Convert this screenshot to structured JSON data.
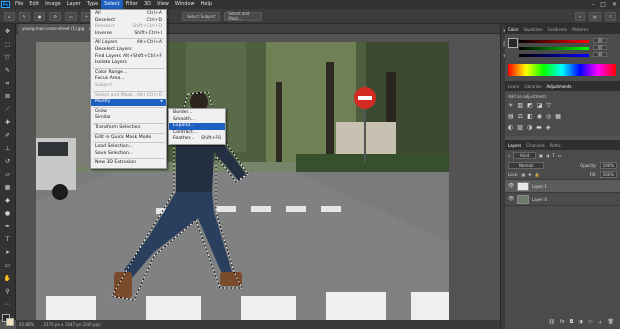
{
  "menubar": {
    "logo": "Ps",
    "items": [
      "File",
      "Edit",
      "Image",
      "Layer",
      "Type",
      "Select",
      "Filter",
      "3D",
      "View",
      "Window",
      "Help"
    ],
    "active_index": 5
  },
  "options": {
    "anti_alias_label": "Anti-alias",
    "select_subject": "Select Subject",
    "select_mask": "Select and Mask..."
  },
  "document": {
    "tab_label": "young-man-cross-street (1).jpg"
  },
  "status": {
    "zoom": "42.86%",
    "info": "2170 px x 1447 px (240 ppi)"
  },
  "select_menu": {
    "items": [
      {
        "label": "All",
        "shortcut": "Ctrl+A",
        "disabled": false
      },
      {
        "label": "Deselect",
        "shortcut": "Ctrl+D",
        "disabled": false
      },
      {
        "label": "Reselect",
        "shortcut": "Shift+Ctrl+D",
        "disabled": true
      },
      {
        "label": "Inverse",
        "shortcut": "Shift+Ctrl+I",
        "disabled": false
      },
      {
        "sep": true
      },
      {
        "label": "All Layers",
        "shortcut": "Alt+Ctrl+A",
        "disabled": false
      },
      {
        "label": "Deselect Layers",
        "shortcut": "",
        "disabled": false
      },
      {
        "label": "Find Layers",
        "shortcut": "Alt+Shift+Ctrl+F",
        "disabled": false
      },
      {
        "label": "Isolate Layers",
        "shortcut": "",
        "disabled": false
      },
      {
        "sep": true
      },
      {
        "label": "Color Range...",
        "shortcut": "",
        "disabled": false
      },
      {
        "label": "Focus Area...",
        "shortcut": "",
        "disabled": false
      },
      {
        "label": "Subject",
        "shortcut": "",
        "disabled": true
      },
      {
        "sep": true
      },
      {
        "label": "Select and Mask...",
        "shortcut": "Alt+Ctrl+R",
        "disabled": true
      },
      {
        "label": "Modify",
        "shortcut": "",
        "disabled": false,
        "highlight": true,
        "submenu": true
      },
      {
        "sep": true
      },
      {
        "label": "Grow",
        "shortcut": "",
        "disabled": false
      },
      {
        "label": "Similar",
        "shortcut": "",
        "disabled": false
      },
      {
        "sep": true
      },
      {
        "label": "Transform Selection",
        "shortcut": "",
        "disabled": false
      },
      {
        "sep": true
      },
      {
        "label": "Edit in Quick Mask Mode",
        "shortcut": "",
        "disabled": false
      },
      {
        "sep": true
      },
      {
        "label": "Load Selection...",
        "shortcut": "",
        "disabled": false
      },
      {
        "label": "Save Selection...",
        "shortcut": "",
        "disabled": false
      },
      {
        "sep": true
      },
      {
        "label": "New 3D Extrusion",
        "shortcut": "",
        "disabled": false
      }
    ]
  },
  "modify_submenu": {
    "items": [
      {
        "label": "Border...",
        "shortcut": "",
        "highlight": false
      },
      {
        "label": "Smooth...",
        "shortcut": "",
        "highlight": false
      },
      {
        "label": "Expand...",
        "shortcut": "",
        "highlight": true
      },
      {
        "label": "Contract...",
        "shortcut": "",
        "highlight": false
      },
      {
        "label": "Feather...",
        "shortcut": "Shift+F6",
        "highlight": false
      }
    ]
  },
  "panels": {
    "color_tabs": [
      "Color",
      "Swatches",
      "Gradients",
      "Patterns"
    ],
    "rgb_values": [
      "40",
      "40",
      "40"
    ],
    "adjust_tabs": [
      "Learn",
      "Libraries",
      "Adjustments"
    ],
    "adjust_hint": "Add an adjustment",
    "layers_tabs": [
      "Layers",
      "Channels",
      "Paths"
    ],
    "kind_label": "Kind",
    "blend_mode": "Normal",
    "opacity_label": "Opacity:",
    "opacity_value": "100%",
    "lock_label": "Lock:",
    "fill_label": "Fill:",
    "fill_value": "100%",
    "layers": [
      {
        "name": "Layer 1",
        "selected": true
      },
      {
        "name": "Layer 0",
        "selected": false
      }
    ]
  },
  "colors": {
    "menu_highlight": "#1f5fbf",
    "panel_bg": "#535353",
    "chrome_dark": "#323232"
  }
}
